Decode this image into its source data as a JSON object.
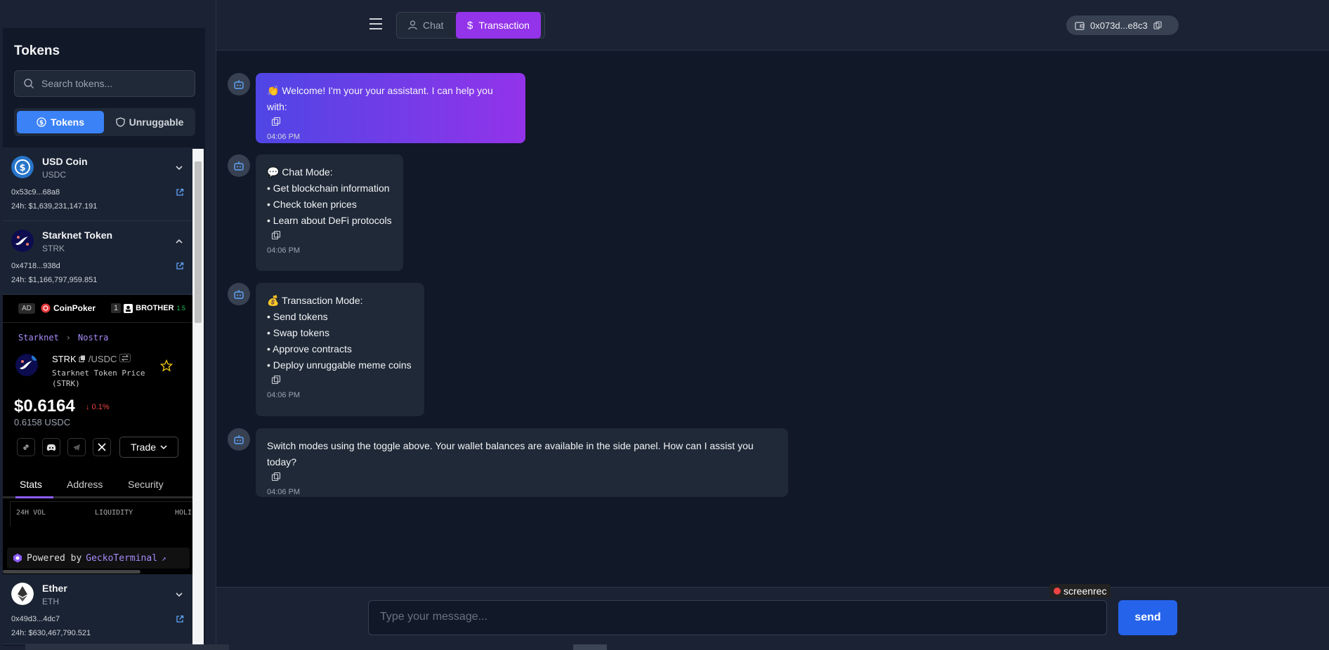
{
  "sidebar": {
    "title": "Tokens",
    "search_placeholder": "Search tokens...",
    "toggle": {
      "tokens": "Tokens",
      "unruggable": "Unruggable"
    },
    "tokens": [
      {
        "name": "USD Coin",
        "symbol": "USDC",
        "address": "0x53c9...68a8",
        "volume": "24h: $1,639,231,147.191"
      },
      {
        "name": "Starknet Token",
        "symbol": "STRK",
        "address": "0x4718...938d",
        "volume": "24h: $1,166,797,959.851"
      },
      {
        "name": "Ether",
        "symbol": "ETH",
        "address": "0x49d3...4dc7",
        "volume": "24h: $630,467,790.521"
      }
    ]
  },
  "gecko": {
    "ad": "AD",
    "sponsor1": "CoinPoker",
    "sponsor2_num": "1",
    "sponsor2": "BROTHER",
    "sponsor2_pct": "1.5",
    "crumb": [
      "Starknet",
      "Nostra"
    ],
    "base": "STRK",
    "quote": "/USDC",
    "subtitle": "Starknet Token Price (STRK)",
    "price": "$0.6164",
    "change": "↓ 0.1%",
    "price_usdc": "0.6158 USDC",
    "trade": "Trade",
    "tabs": [
      "Stats",
      "Address",
      "Security"
    ],
    "stats_headers": [
      "24H VOL",
      "LIQUIDITY",
      "HOLI"
    ],
    "powered_by": "Powered by",
    "powered_brand": "GeckoTerminal",
    "powered_arrow": "↗"
  },
  "header": {
    "mode_chat": "Chat",
    "mode_transaction": "Transaction",
    "wallet": "0x073d...e8c3"
  },
  "messages": [
    {
      "lines": [
        "👏 Welcome! I'm your your assistant. I can help you with:"
      ],
      "time": "04:06 PM"
    },
    {
      "lines": [
        "💬 Chat Mode:",
        "• Get blockchain information",
        "• Check token prices",
        "• Learn about DeFi protocols"
      ],
      "time": "04:06 PM"
    },
    {
      "lines": [
        "💰 Transaction Mode:",
        "• Send tokens",
        "• Swap tokens",
        "• Approve contracts",
        "• Deploy unruggable meme coins"
      ],
      "time": "04:06 PM"
    },
    {
      "lines": [
        "Switch modes using the toggle above. Your wallet balances are available in the side panel. How can I assist you today?"
      ],
      "time": "04:06 PM"
    }
  ],
  "input": {
    "placeholder": "Type your message...",
    "send": "send"
  },
  "overlay": {
    "screenrec": "screenrec"
  },
  "colors": {
    "accent_purple": "#9333ea",
    "accent_blue": "#3b82f6",
    "send_blue": "#2563eb",
    "bg": "#111827"
  }
}
